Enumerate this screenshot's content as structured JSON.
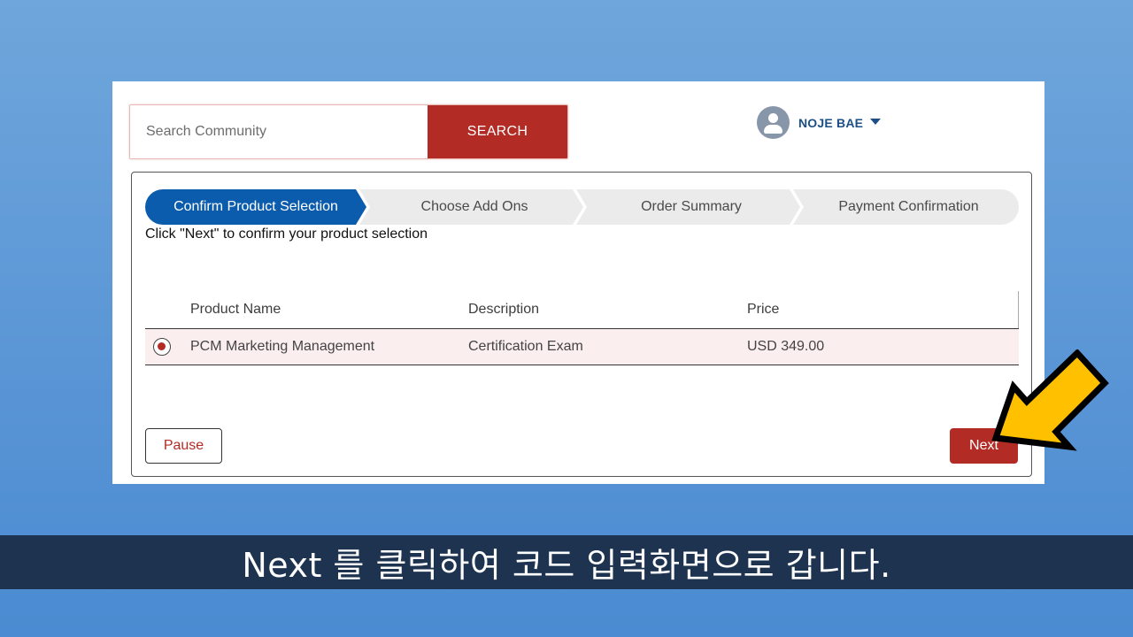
{
  "header": {
    "search": {
      "placeholder": "Search Community",
      "value": "",
      "button_label": "SEARCH"
    },
    "user": {
      "name": "NOJE BAE",
      "avatar_icon": "user-avatar-icon",
      "menu_icon": "caret-down-icon"
    }
  },
  "stepper": {
    "steps": [
      {
        "label": "Confirm Product Selection",
        "active": true
      },
      {
        "label": "Choose Add Ons",
        "active": false
      },
      {
        "label": "Order Summary",
        "active": false
      },
      {
        "label": "Payment Confirmation",
        "active": false
      }
    ],
    "active_color": "#0b5cad",
    "inactive_color": "#ebebeb"
  },
  "instruction": "Click \"Next\" to confirm your product selection",
  "table": {
    "columns": [
      "Product Name",
      "Description",
      "Price"
    ],
    "rows": [
      {
        "selected": true,
        "product_name": "PCM Marketing Management",
        "description": "Certification Exam",
        "price": "USD 349.00"
      }
    ]
  },
  "actions": {
    "pause_label": "Pause",
    "next_label": "Next"
  },
  "colors": {
    "brand_red": "#b32b25",
    "arrow_yellow": "#ffc000"
  },
  "caption": {
    "text": "Next 를 클릭하여 코드 입력화면으로 갑니다."
  }
}
